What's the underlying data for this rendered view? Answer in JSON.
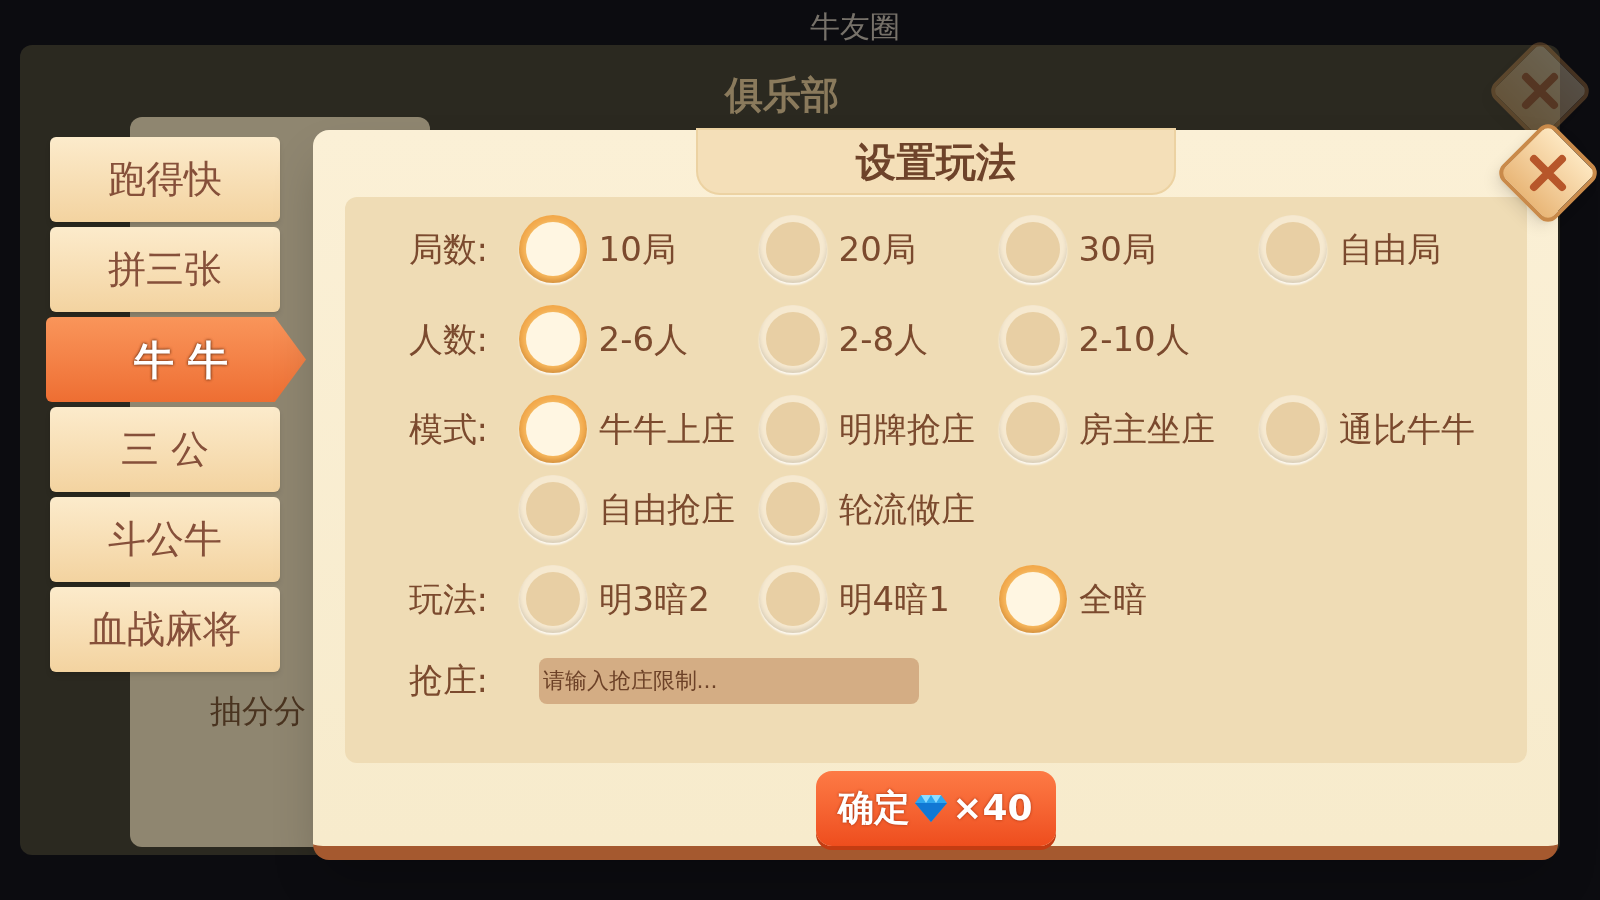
{
  "background": {
    "title": "牛友圈",
    "club_title": "俱乐部",
    "fragment": "抽分分"
  },
  "game_tabs": [
    {
      "label": "跑得快",
      "selected": false
    },
    {
      "label": "拼三张",
      "selected": false
    },
    {
      "label": "牛 牛",
      "selected": true
    },
    {
      "label": "三 公",
      "selected": false
    },
    {
      "label": "斗公牛",
      "selected": false
    },
    {
      "label": "血战麻将",
      "selected": false
    }
  ],
  "dialog": {
    "title": "设置玩法",
    "rows": [
      {
        "label": "局数:",
        "options": [
          {
            "label": "10局",
            "selected": true
          },
          {
            "label": "20局",
            "selected": false
          },
          {
            "label": "30局",
            "selected": false
          },
          {
            "label": "自由局",
            "selected": false
          }
        ]
      },
      {
        "label": "人数:",
        "options": [
          {
            "label": "2-6人",
            "selected": true
          },
          {
            "label": "2-8人",
            "selected": false
          },
          {
            "label": "2-10人",
            "selected": false
          }
        ]
      },
      {
        "label": "模式:",
        "options": [
          {
            "label": "牛牛上庄",
            "selected": true
          },
          {
            "label": "明牌抢庄",
            "selected": false
          },
          {
            "label": "房主坐庄",
            "selected": false
          },
          {
            "label": "通比牛牛",
            "selected": false
          },
          {
            "label": "自由抢庄",
            "selected": false
          },
          {
            "label": "轮流做庄",
            "selected": false
          }
        ]
      },
      {
        "label": "玩法:",
        "options": [
          {
            "label": "明3暗2",
            "selected": false
          },
          {
            "label": "明4暗1",
            "selected": false
          },
          {
            "label": "全暗",
            "selected": true
          }
        ]
      }
    ],
    "banker_limit": {
      "label": "抢庄:",
      "placeholder": "请输入抢庄限制..."
    },
    "confirm": {
      "label": "确定",
      "cost": "×40"
    }
  }
}
